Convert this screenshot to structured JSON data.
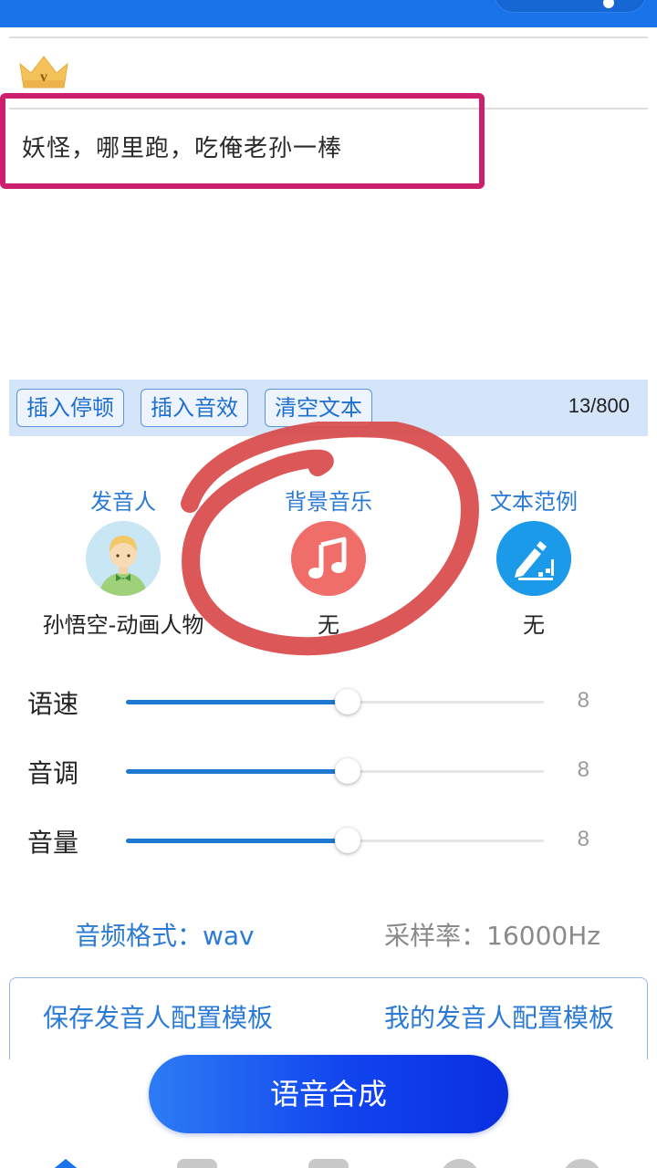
{
  "colors": {
    "accent": "#1a73e8",
    "link_blue": "#2b7ad6",
    "highlight_box": "#cc1f6e",
    "annotation_red": "#d94a4a",
    "music_icon_bg": "#ef6e6a",
    "example_icon_bg": "#1a9ae8"
  },
  "editor": {
    "text": "妖怪，哪里跑，吃俺老孙一棒",
    "vip_badge": "v"
  },
  "toolbar": {
    "insert_pause": "插入停顿",
    "insert_effect": "插入音效",
    "clear_text": "清空文本",
    "counter": "13/800"
  },
  "options": {
    "speaker": {
      "title": "发音人",
      "value": "孙悟空-动画人物",
      "icon": "cartoon-avatar-icon"
    },
    "bgm": {
      "title": "背景音乐",
      "value": "无",
      "icon": "music-note-icon"
    },
    "example": {
      "title": "文本范例",
      "value": "无",
      "icon": "edit-pencil-icon"
    }
  },
  "sliders": [
    {
      "label": "语速",
      "value": "8",
      "level": 0.53
    },
    {
      "label": "音调",
      "value": "8",
      "level": 0.53
    },
    {
      "label": "音量",
      "value": "8",
      "level": 0.53
    }
  ],
  "audio": {
    "format": "音频格式：wav",
    "sample_rate": "采样率：16000Hz"
  },
  "templates": {
    "save": "保存发音人配置模板",
    "mine": "我的发音人配置模板"
  },
  "synthesize_label": "语音合成"
}
